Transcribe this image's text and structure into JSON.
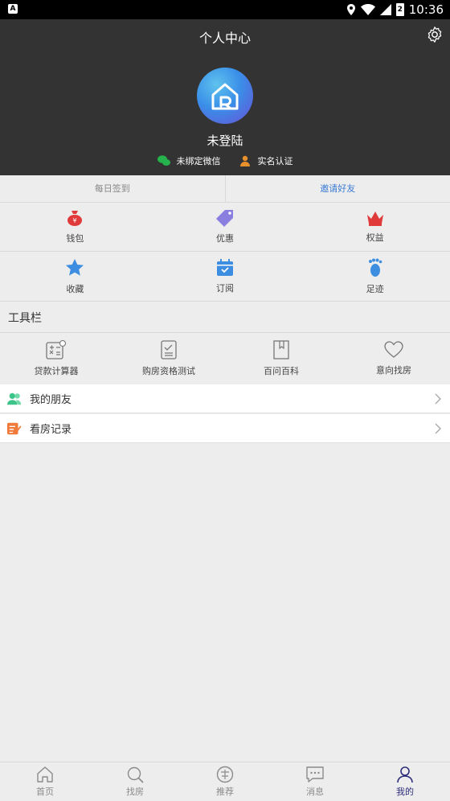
{
  "status": {
    "notif_label": "A",
    "time": "10:36",
    "battery_digit": "2"
  },
  "header": {
    "title": "个人中心",
    "username": "未登陆",
    "binds": [
      {
        "label": "未绑定微信"
      },
      {
        "label": "实名认证"
      }
    ]
  },
  "tabs": {
    "signin": "每日签到",
    "invite": "邀请好友"
  },
  "grid": [
    {
      "label": "钱包",
      "icon": "wallet-icon"
    },
    {
      "label": "优惠",
      "icon": "tag-icon"
    },
    {
      "label": "权益",
      "icon": "crown-icon"
    },
    {
      "label": "收藏",
      "icon": "star-icon"
    },
    {
      "label": "订阅",
      "icon": "calendar-icon"
    },
    {
      "label": "足迹",
      "icon": "footprint-icon"
    }
  ],
  "toolbar": {
    "title": "工具栏",
    "items": [
      {
        "label": "贷款计算器",
        "icon": "calculator-icon"
      },
      {
        "label": "购房资格测试",
        "icon": "checklist-icon"
      },
      {
        "label": "百问百科",
        "icon": "book-icon"
      },
      {
        "label": "意向找房",
        "icon": "heart-icon"
      }
    ]
  },
  "list": [
    {
      "label": "我的朋友",
      "icon": "friends-icon"
    },
    {
      "label": "看房记录",
      "icon": "record-icon"
    }
  ],
  "bottom_nav": [
    {
      "label": "首页",
      "icon": "home-icon"
    },
    {
      "label": "找房",
      "icon": "search-icon"
    },
    {
      "label": "推荐",
      "icon": "recommend-icon"
    },
    {
      "label": "消息",
      "icon": "message-icon"
    },
    {
      "label": "我的",
      "icon": "user-icon",
      "active": true
    }
  ],
  "colors": {
    "header_bg": "#333333",
    "accent": "#3a7bd5",
    "active_nav": "#2d2f7a"
  }
}
